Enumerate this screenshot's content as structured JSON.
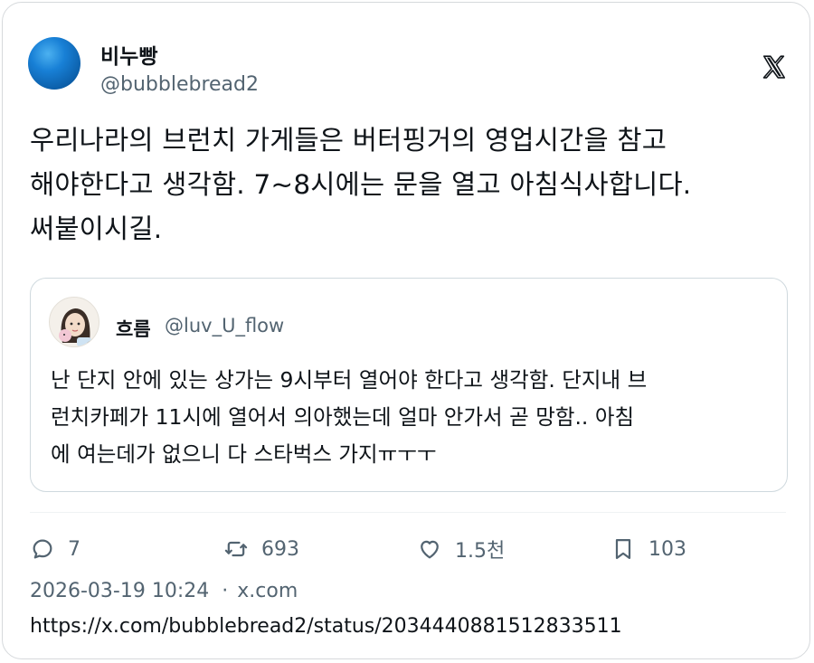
{
  "post": {
    "author_name": "비누빵",
    "author_handle": "@bubblebread2",
    "text": "우리나라의 브런치 가게들은 버터핑거의 영업시간을 참고\n해야한다고 생각함. 7~8시에는 문을 열고 아침식사합니다.\n써붙이시길.",
    "platform_icon": "x-logo-icon"
  },
  "quoted": {
    "author_name": "흐름",
    "author_handle": "@luv_U_flow",
    "text": "난 단지 안에 있는 상가는 9시부터 열어야 한다고 생각함. 단지내 브\n런치카페가 11시에 열어서 의아했는데 얼마 안가서 곧 망함.. 아침\n에 여는데가 없으니 다 스타벅스 가지ㅠㅜㅜ"
  },
  "actions": {
    "reply_count": "7",
    "repost_count": "693",
    "like_count": "1.5천",
    "bookmark_count": "103"
  },
  "meta": {
    "timestamp": "2026-03-19 10:24",
    "separator": "·",
    "source": "x.com",
    "url": "https://x.com/bubblebread2/status/2034440881512833511"
  },
  "colors": {
    "text": "#0f1419",
    "secondary": "#536471",
    "border": "#cfd9de",
    "avatar": "#1880d6"
  }
}
